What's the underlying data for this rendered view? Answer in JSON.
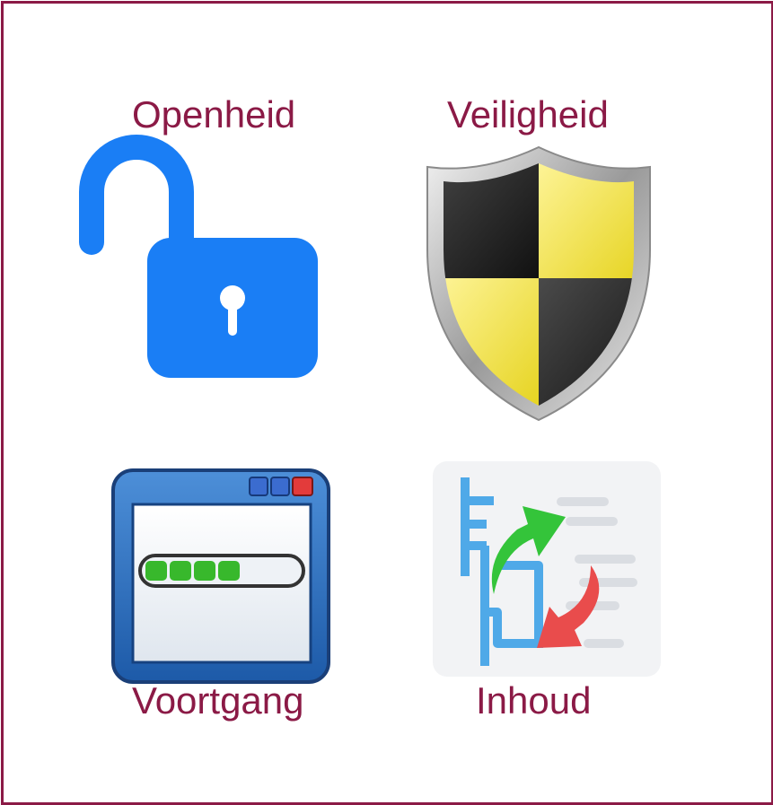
{
  "tiles": [
    {
      "label": "Openheid",
      "icon": "open-padlock-icon",
      "color": "#1a7ef5"
    },
    {
      "label": "Veiligheid",
      "icon": "security-shield-icon",
      "color": "#f5e43a"
    },
    {
      "label": "Voortgang",
      "icon": "progress-window-icon",
      "color": "#2f7fd0"
    },
    {
      "label": "Inhoud",
      "icon": "content-transfer-icon",
      "color": "#e94c4c"
    }
  ],
  "colors": {
    "border": "#8b1a46",
    "label": "#8b1a46"
  }
}
